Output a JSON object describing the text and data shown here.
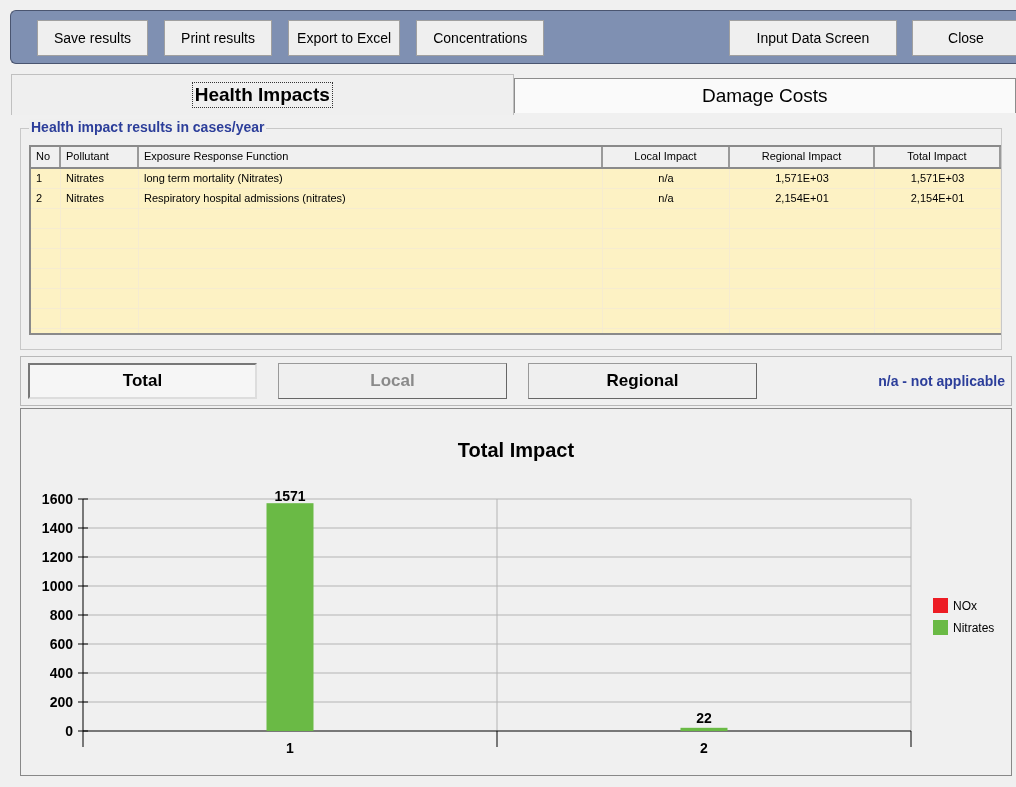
{
  "toolbar": {
    "buttons_left": [
      "Save results",
      "Print results",
      "Export to Excel",
      "Concentrations"
    ],
    "buttons_right": [
      "Input Data Screen",
      "Close"
    ]
  },
  "tabs": [
    {
      "label": "Health Impacts",
      "selected": true
    },
    {
      "label": "Damage Costs",
      "selected": false
    }
  ],
  "results_group": {
    "title": "Health impact results in cases/year",
    "table": {
      "columns": [
        "No",
        "Pollutant",
        "Exposure Response Function",
        "Local Impact",
        "Regional Impact",
        "Total Impact"
      ],
      "rows": [
        [
          "1",
          "Nitrates",
          "long term mortality (Nitrates)",
          "n/a",
          "1,571E+03",
          "1,571E+03"
        ],
        [
          "2",
          "Nitrates",
          "Respiratory hospital admissions (nitrates)",
          "n/a",
          "2,154E+01",
          "2,154E+01"
        ]
      ]
    }
  },
  "view_buttons": [
    {
      "label": "Total",
      "selected": true,
      "disabled": false
    },
    {
      "label": "Local",
      "selected": false,
      "disabled": true
    },
    {
      "label": "Regional",
      "selected": false,
      "disabled": false
    }
  ],
  "note": "n/a - not applicable",
  "chart": {
    "chart_data": {
      "type": "bar",
      "title": "Total Impact",
      "categories": [
        "1",
        "2"
      ],
      "series": [
        {
          "name": "NOx",
          "color": "#ed1c24",
          "values": [
            null,
            null
          ]
        },
        {
          "name": "Nitrates",
          "color": "#6aba45",
          "values": [
            1571,
            22
          ]
        }
      ],
      "ylim": [
        0,
        1600
      ],
      "yticks": [
        0,
        200,
        400,
        600,
        800,
        1000,
        1200,
        1400,
        1600
      ],
      "data_labels": true,
      "grid": true
    }
  }
}
